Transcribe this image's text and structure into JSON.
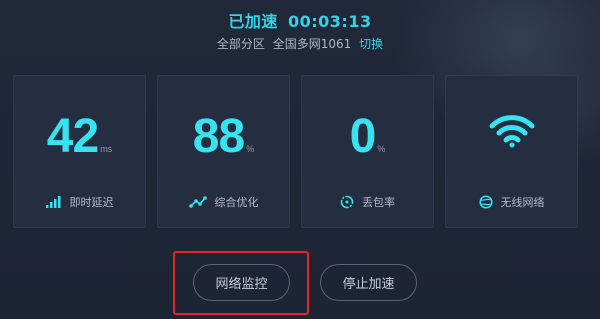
{
  "header": {
    "status_label": "已加速",
    "elapsed_time": "00:03:13",
    "region_scope": "全部分区",
    "server_name": "全国多网1061",
    "switch_label": "切换"
  },
  "cards": [
    {
      "value": "42",
      "unit": "ms",
      "label": "即时延迟",
      "icon": "signal-bars-icon"
    },
    {
      "value": "88",
      "unit": "%",
      "label": "综合优化",
      "icon": "trend-line-icon"
    },
    {
      "value": "0",
      "unit": "%",
      "label": "丢包率",
      "icon": "packet-loss-icon"
    },
    {
      "value": "",
      "unit": "",
      "label": "无线网络",
      "icon": "wifi-icon",
      "sub_icon": "globe-icon"
    }
  ],
  "actions": {
    "monitor_label": "网络监控",
    "stop_label": "停止加速"
  },
  "colors": {
    "accent": "#36e3ee",
    "background": "#1e2535",
    "card": "#252e40",
    "highlight": "#e3262a"
  }
}
